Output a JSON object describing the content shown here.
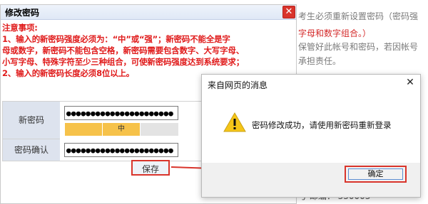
{
  "background": {
    "lines": [
      "考生必须重新设置密码（密码强",
      "字母和数字组合。）",
      "保管好此帐号和密码，若因帐号",
      "承担责任。"
    ],
    "bottom_text": "号  邮编： 330003"
  },
  "password_dialog": {
    "title": "修改密码",
    "close_label": "✕",
    "notices": [
      "注意事项:",
      "1、输入的新密码强度必须为：“中”或“强”；新密码不能全是字",
      "母或数字，新密码不能包含空格，新密码需要包含数字、大写字母、",
      "小写字母、特殊字符至少三种组合，可使新密码强度达到系统要求；",
      "2、输入的新密码长度必须8位以上。"
    ],
    "new_password_label": "新密码",
    "new_password_value": "●●●●●●●●●●●●●●●●●●●●●●",
    "strength": {
      "level_text": "中",
      "value": 0.66
    },
    "confirm_label": "密码确认",
    "confirm_value": "●●●●●●●●●●●●●●●●●●●●●●",
    "save_label": "保存"
  },
  "alert_dialog": {
    "title": "来自网页的消息",
    "close_label": "✕",
    "message": "密码修改成功，请使用新密码重新登录",
    "ok_label": "确定"
  },
  "colors": {
    "accent_red": "#d9342b",
    "strength_orange": "#f6c24a",
    "notice_red": "#e01b1b"
  }
}
